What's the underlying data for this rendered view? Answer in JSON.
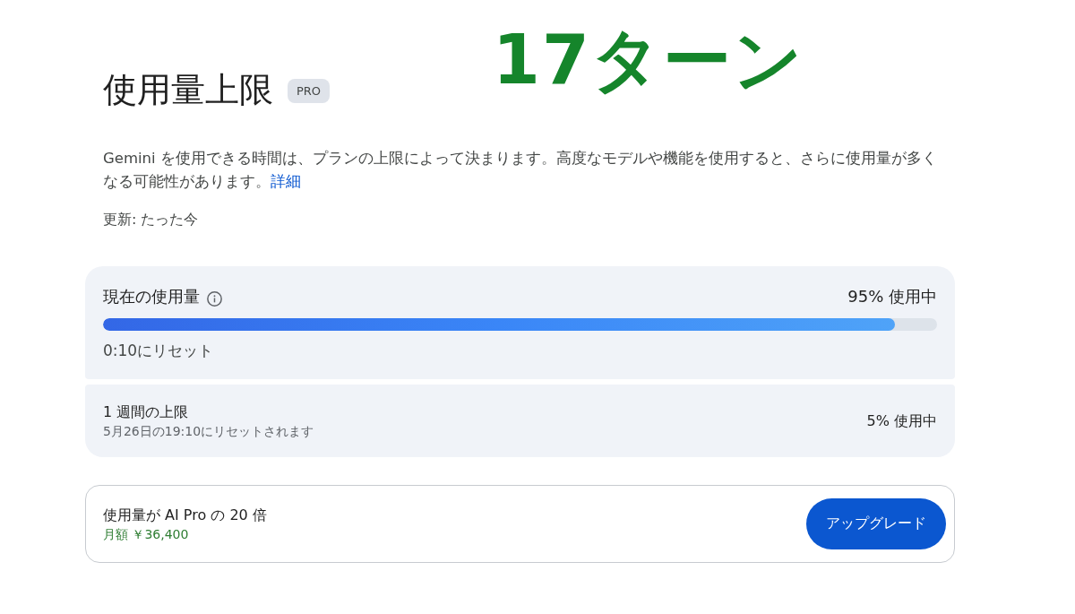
{
  "header": {
    "title": "使用量上限",
    "badge": "PRO"
  },
  "annotation": {
    "text": "17ターン"
  },
  "description": {
    "text": "Gemini を使用できる時間は、プランの上限によって決まります。高度なモデルや機能を使用すると、さらに使用量が多くなる可能性があります。",
    "link": "詳細"
  },
  "updated": "更新: たった今",
  "limits": [
    {
      "kind": "meter",
      "title": "現在の使用量",
      "reading": "95% 使用中",
      "level": 0.95,
      "reset": "0:10にリセット"
    },
    {
      "kind": "summary",
      "title": "1 週間の上限",
      "reading": "5% 使用中",
      "reset": "5月26日の19:10にリセットされます"
    }
  ],
  "upgrade": {
    "title": "使用量が AI Pro の 20 倍",
    "price": "月額 ￥36,400",
    "button": "アップグレード"
  }
}
